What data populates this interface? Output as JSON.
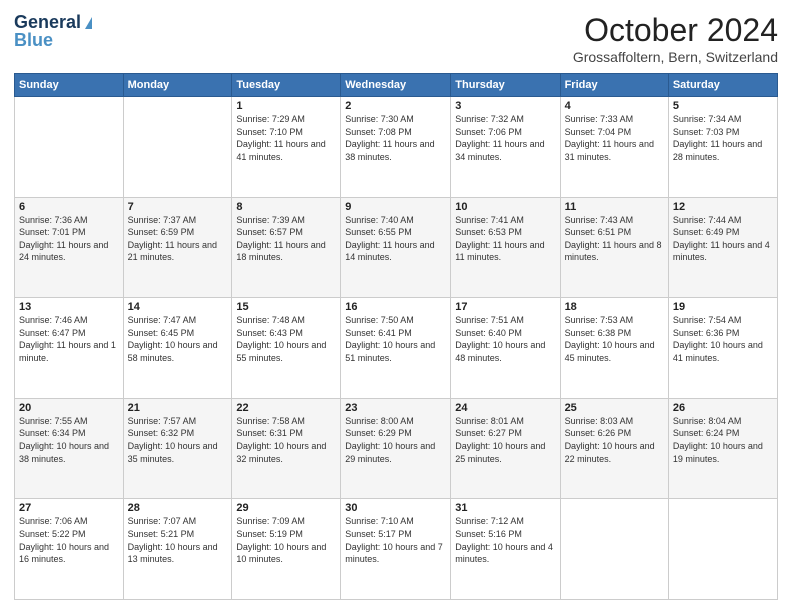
{
  "header": {
    "logo_general": "General",
    "logo_blue": "Blue",
    "title": "October 2024",
    "subtitle": "Grossaffoltern, Bern, Switzerland"
  },
  "weekdays": [
    "Sunday",
    "Monday",
    "Tuesday",
    "Wednesday",
    "Thursday",
    "Friday",
    "Saturday"
  ],
  "weeks": [
    [
      {
        "day": "",
        "sunrise": "",
        "sunset": "",
        "daylight": ""
      },
      {
        "day": "",
        "sunrise": "",
        "sunset": "",
        "daylight": ""
      },
      {
        "day": "1",
        "sunrise": "Sunrise: 7:29 AM",
        "sunset": "Sunset: 7:10 PM",
        "daylight": "Daylight: 11 hours and 41 minutes."
      },
      {
        "day": "2",
        "sunrise": "Sunrise: 7:30 AM",
        "sunset": "Sunset: 7:08 PM",
        "daylight": "Daylight: 11 hours and 38 minutes."
      },
      {
        "day": "3",
        "sunrise": "Sunrise: 7:32 AM",
        "sunset": "Sunset: 7:06 PM",
        "daylight": "Daylight: 11 hours and 34 minutes."
      },
      {
        "day": "4",
        "sunrise": "Sunrise: 7:33 AM",
        "sunset": "Sunset: 7:04 PM",
        "daylight": "Daylight: 11 hours and 31 minutes."
      },
      {
        "day": "5",
        "sunrise": "Sunrise: 7:34 AM",
        "sunset": "Sunset: 7:03 PM",
        "daylight": "Daylight: 11 hours and 28 minutes."
      }
    ],
    [
      {
        "day": "6",
        "sunrise": "Sunrise: 7:36 AM",
        "sunset": "Sunset: 7:01 PM",
        "daylight": "Daylight: 11 hours and 24 minutes."
      },
      {
        "day": "7",
        "sunrise": "Sunrise: 7:37 AM",
        "sunset": "Sunset: 6:59 PM",
        "daylight": "Daylight: 11 hours and 21 minutes."
      },
      {
        "day": "8",
        "sunrise": "Sunrise: 7:39 AM",
        "sunset": "Sunset: 6:57 PM",
        "daylight": "Daylight: 11 hours and 18 minutes."
      },
      {
        "day": "9",
        "sunrise": "Sunrise: 7:40 AM",
        "sunset": "Sunset: 6:55 PM",
        "daylight": "Daylight: 11 hours and 14 minutes."
      },
      {
        "day": "10",
        "sunrise": "Sunrise: 7:41 AM",
        "sunset": "Sunset: 6:53 PM",
        "daylight": "Daylight: 11 hours and 11 minutes."
      },
      {
        "day": "11",
        "sunrise": "Sunrise: 7:43 AM",
        "sunset": "Sunset: 6:51 PM",
        "daylight": "Daylight: 11 hours and 8 minutes."
      },
      {
        "day": "12",
        "sunrise": "Sunrise: 7:44 AM",
        "sunset": "Sunset: 6:49 PM",
        "daylight": "Daylight: 11 hours and 4 minutes."
      }
    ],
    [
      {
        "day": "13",
        "sunrise": "Sunrise: 7:46 AM",
        "sunset": "Sunset: 6:47 PM",
        "daylight": "Daylight: 11 hours and 1 minute."
      },
      {
        "day": "14",
        "sunrise": "Sunrise: 7:47 AM",
        "sunset": "Sunset: 6:45 PM",
        "daylight": "Daylight: 10 hours and 58 minutes."
      },
      {
        "day": "15",
        "sunrise": "Sunrise: 7:48 AM",
        "sunset": "Sunset: 6:43 PM",
        "daylight": "Daylight: 10 hours and 55 minutes."
      },
      {
        "day": "16",
        "sunrise": "Sunrise: 7:50 AM",
        "sunset": "Sunset: 6:41 PM",
        "daylight": "Daylight: 10 hours and 51 minutes."
      },
      {
        "day": "17",
        "sunrise": "Sunrise: 7:51 AM",
        "sunset": "Sunset: 6:40 PM",
        "daylight": "Daylight: 10 hours and 48 minutes."
      },
      {
        "day": "18",
        "sunrise": "Sunrise: 7:53 AM",
        "sunset": "Sunset: 6:38 PM",
        "daylight": "Daylight: 10 hours and 45 minutes."
      },
      {
        "day": "19",
        "sunrise": "Sunrise: 7:54 AM",
        "sunset": "Sunset: 6:36 PM",
        "daylight": "Daylight: 10 hours and 41 minutes."
      }
    ],
    [
      {
        "day": "20",
        "sunrise": "Sunrise: 7:55 AM",
        "sunset": "Sunset: 6:34 PM",
        "daylight": "Daylight: 10 hours and 38 minutes."
      },
      {
        "day": "21",
        "sunrise": "Sunrise: 7:57 AM",
        "sunset": "Sunset: 6:32 PM",
        "daylight": "Daylight: 10 hours and 35 minutes."
      },
      {
        "day": "22",
        "sunrise": "Sunrise: 7:58 AM",
        "sunset": "Sunset: 6:31 PM",
        "daylight": "Daylight: 10 hours and 32 minutes."
      },
      {
        "day": "23",
        "sunrise": "Sunrise: 8:00 AM",
        "sunset": "Sunset: 6:29 PM",
        "daylight": "Daylight: 10 hours and 29 minutes."
      },
      {
        "day": "24",
        "sunrise": "Sunrise: 8:01 AM",
        "sunset": "Sunset: 6:27 PM",
        "daylight": "Daylight: 10 hours and 25 minutes."
      },
      {
        "day": "25",
        "sunrise": "Sunrise: 8:03 AM",
        "sunset": "Sunset: 6:26 PM",
        "daylight": "Daylight: 10 hours and 22 minutes."
      },
      {
        "day": "26",
        "sunrise": "Sunrise: 8:04 AM",
        "sunset": "Sunset: 6:24 PM",
        "daylight": "Daylight: 10 hours and 19 minutes."
      }
    ],
    [
      {
        "day": "27",
        "sunrise": "Sunrise: 7:06 AM",
        "sunset": "Sunset: 5:22 PM",
        "daylight": "Daylight: 10 hours and 16 minutes."
      },
      {
        "day": "28",
        "sunrise": "Sunrise: 7:07 AM",
        "sunset": "Sunset: 5:21 PM",
        "daylight": "Daylight: 10 hours and 13 minutes."
      },
      {
        "day": "29",
        "sunrise": "Sunrise: 7:09 AM",
        "sunset": "Sunset: 5:19 PM",
        "daylight": "Daylight: 10 hours and 10 minutes."
      },
      {
        "day": "30",
        "sunrise": "Sunrise: 7:10 AM",
        "sunset": "Sunset: 5:17 PM",
        "daylight": "Daylight: 10 hours and 7 minutes."
      },
      {
        "day": "31",
        "sunrise": "Sunrise: 7:12 AM",
        "sunset": "Sunset: 5:16 PM",
        "daylight": "Daylight: 10 hours and 4 minutes."
      },
      {
        "day": "",
        "sunrise": "",
        "sunset": "",
        "daylight": ""
      },
      {
        "day": "",
        "sunrise": "",
        "sunset": "",
        "daylight": ""
      }
    ]
  ]
}
